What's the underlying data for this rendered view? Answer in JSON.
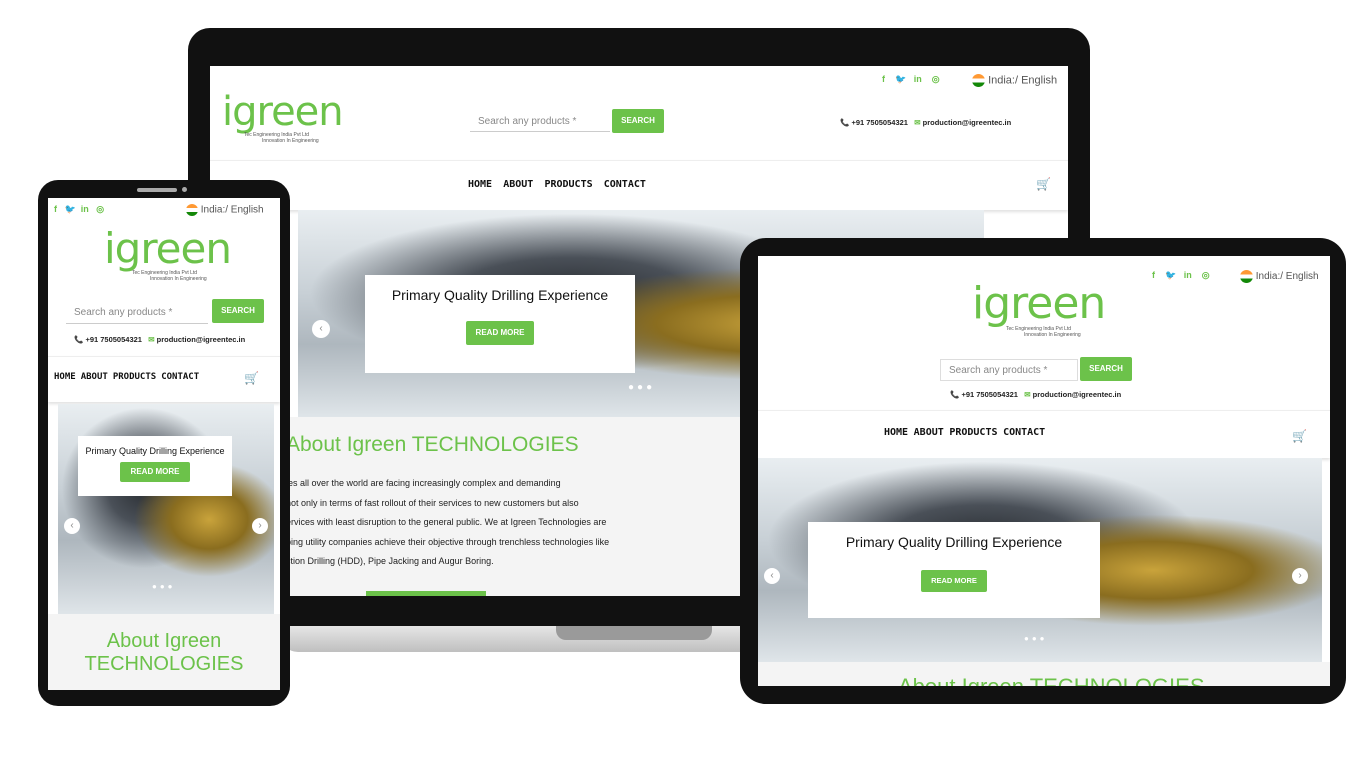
{
  "brand": {
    "logo": "igreen",
    "tagline_1": "Tec Engineering India Pvt Ltd",
    "tagline_2": "Innovation In Engineering"
  },
  "locale": "India:/ English",
  "search": {
    "placeholder": "Search any products *",
    "button": "SEARCH"
  },
  "contact": {
    "phone": "+91 7505054321",
    "email": "production@igreentec.in"
  },
  "nav": [
    "HOME",
    "ABOUT",
    "PRODUCTS",
    "CONTACT"
  ],
  "hero": {
    "caption": "Primary Quality Drilling Experience",
    "button": "READ MORE"
  },
  "about": {
    "title_desktop": "About Igreen TECHNOLOGIES",
    "title_mobile_1": "About Igreen",
    "title_mobile_2": "TECHNOLOGIES",
    "lines": [
      "ies all over the world are facing increasingly complex and demanding",
      "not only in terms of fast rollout of their services to new customers but also",
      "ervices with least disruption to the general public. We at Igreen Technologies are",
      "ping utility companies achieve their objective through trenchless technologies like",
      "ction Drilling (HDD), Pipe Jacking and Augur Boring."
    ]
  },
  "social_icons": [
    "facebook-icon",
    "twitter-icon",
    "linkedin-icon",
    "instagram-icon"
  ],
  "colors": {
    "accent": "#6cc24a",
    "device_frame": "#111111",
    "laptop_base": "#c8c8c8"
  }
}
